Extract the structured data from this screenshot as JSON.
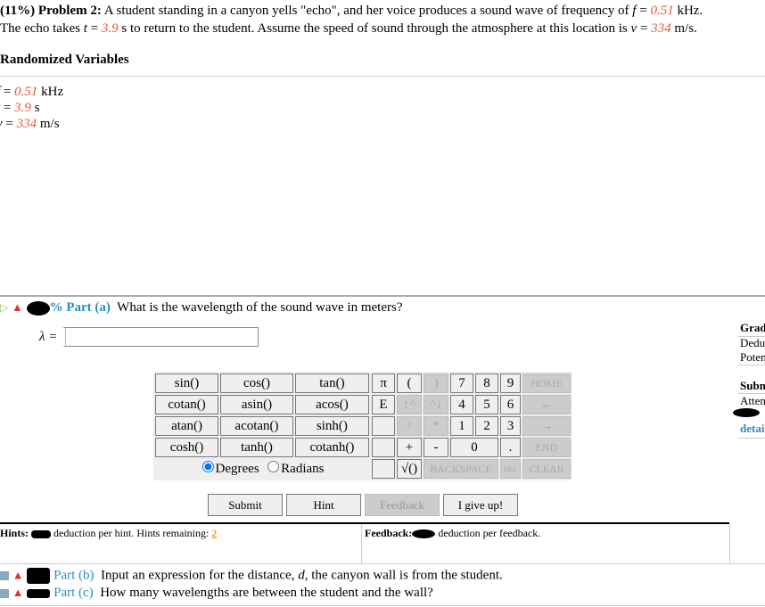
{
  "problem": {
    "prefix": "(11%)  Problem 2:",
    "t1": "  A student standing in a canyon yells \"echo\", and her voice produces a sound wave of frequency of ",
    "f_sym": "f",
    "eq": " = ",
    "f_val": "0.51",
    "f_unit": " kHz.",
    "t2": "The echo takes ",
    "t_sym": "t",
    "t_val": "3.9",
    "t2b": " s to return to the student. Assume the speed of sound through the atmosphere at this location is ",
    "v_sym": "v",
    "v_val": "334",
    "v_unit": " m/s."
  },
  "randomized": {
    "title": "Randomized Variables",
    "vars": [
      {
        "sym": "f",
        "val": "0.51",
        "unit": " kHz"
      },
      {
        "sym": "t",
        "val": "3.9",
        "unit": " s"
      },
      {
        "sym": "v",
        "val": "334",
        "unit": " m/s"
      }
    ]
  },
  "part_a": {
    "pct": "%",
    "label": "Part (a)",
    "question": "What is the wavelength of the sound wave in meters?",
    "var_label": "λ =",
    "input_value": ""
  },
  "keypad": {
    "funcs": [
      [
        "sin()",
        "cos()",
        "tan()"
      ],
      [
        "cotan()",
        "asin()",
        "acos()"
      ],
      [
        "atan()",
        "acotan()",
        "sinh()"
      ],
      [
        "cosh()",
        "tanh()",
        "cotanh()"
      ]
    ],
    "keys": {
      "pi": "π",
      "lp": "(",
      "rp": ")",
      "k7": "7",
      "k8": "8",
      "k9": "9",
      "home": "HOME",
      "e": "E",
      "up": "↑^",
      "down": "^↓",
      "k4": "4",
      "k5": "5",
      "k6": "6",
      "left": "←",
      "div": "/",
      "mul": "*",
      "k1": "1",
      "k2": "2",
      "k3": "3",
      "right": "→",
      "plus": "+",
      "minus": "-",
      "k0": "0",
      "dot": ".",
      "end": "END",
      "sqrt": "√()",
      "backspace": "BACKSPACE",
      "del": "DEL",
      "clear": "CLEAR"
    },
    "degrees": "Degrees",
    "radians": "Radians",
    "mode": "Degrees"
  },
  "buttons": {
    "submit": "Submit",
    "hint": "Hint",
    "feedback": "Feedback",
    "giveup": "I give up!"
  },
  "hints": {
    "label": "Hints:",
    "text": " deduction per hint. Hints remaining: ",
    "remaining": "2"
  },
  "feedback": {
    "label": "Feedback:",
    "text": " deduction per feedback."
  },
  "part_b": {
    "label": "Part (b)",
    "q1": "Input an expression for the distance, ",
    "sym": "d",
    "q2": ", the canyon wall is from the student."
  },
  "part_c": {
    "label": "Part (c)",
    "question": "How many wavelengths are between the student and the wall?"
  },
  "side": {
    "grade": "Grad",
    "dedu": "Dedu",
    "poten": "Poten",
    "subm": "Subm",
    "atten": "Atten",
    "detai": "detai"
  }
}
